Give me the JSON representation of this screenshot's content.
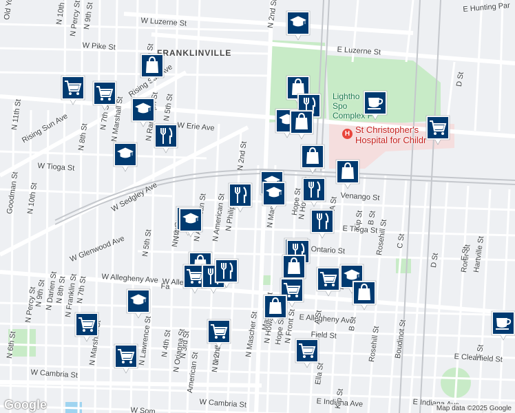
{
  "map": {
    "area_label": "FRANKLINVILLE",
    "park_label": "Lighthouse Sports Complex Field",
    "park_label_visible": "Lightho\nSpo\nComplex F",
    "hospital_label": "St Christopher's\nHospital for Children",
    "hospital_label_visible": "St Christopher's\nHospital for Childr",
    "hospital_icon": "H",
    "google_logo": "Google",
    "attribution": "Map data ©2025 Google",
    "street_labels": [
      "E Hunting Par",
      "W Luzerne St",
      "E Luzerne St",
      "W Pike St",
      "N 10th St",
      "N Percy St",
      "N 9th St",
      "N 6th St",
      "Rising Sun Ave",
      "N 5th St",
      "W Erie Ave",
      "N Randolph St",
      "N Marshall St",
      "N 7th St",
      "N 8th St",
      "N 11th St",
      "Rising Sun Ave",
      "W Tioga St",
      "W Sedgley Ave",
      "N 10th St",
      "Goodman St",
      "W Glenwood Ave",
      "N 5th St",
      "N 4th St",
      "N American St",
      "N Philip St",
      "N 2nd St",
      "N Mascher St",
      "N Howard St",
      "Hope St",
      "Venango St",
      "E Tioga St",
      "B St",
      "Kip St",
      "Rosehill St",
      "C St",
      "D St",
      "Ontario St",
      "Rorer St",
      "Hartville St",
      "E St",
      "W Allegheny Ave",
      "E Allegheny Ave",
      "N Percy St",
      "N 9th St",
      "N Darien St",
      "N 8th St",
      "N Franklin St",
      "N 7th St",
      "N 6th St",
      "N Marshall St",
      "N Lawrence St",
      "N 4th St",
      "N Orianna St",
      "N 3rd St",
      "American St",
      "N 2nd St",
      "N Mascher St",
      "N Howard St",
      "Hope St",
      "N Front St",
      "A St",
      "B St",
      "Rosehill St",
      "Boudinot St",
      "F St",
      "E Clearfield St",
      "Field St",
      "Ella St",
      "E Indiana Ave",
      "E Indiana Ave",
      "W Cambria St",
      "W Cambria St",
      "Old York Rd",
      "N 2nd St",
      "D St",
      "Kip St",
      "A St",
      "W Som",
      "Kip St",
      "N 2nd St",
      "Mascher St",
      "W Allegheny Ave",
      "Fa",
      "N American St",
      "N 4th St",
      "E A"
    ],
    "markers": [
      {
        "type": "school",
        "icon": "graduation-cap-icon"
      },
      {
        "type": "shopping",
        "icon": "shopping-bag-icon"
      },
      {
        "type": "grocery",
        "icon": "shopping-cart-icon"
      },
      {
        "type": "grocery",
        "icon": "shopping-cart-icon"
      },
      {
        "type": "shopping",
        "icon": "shopping-bag-icon"
      },
      {
        "type": "restaurant",
        "icon": "fork-knife-icon"
      },
      {
        "type": "cafe",
        "icon": "coffee-cup-icon"
      },
      {
        "type": "school",
        "icon": "graduation-cap-icon"
      },
      {
        "type": "school",
        "icon": "graduation-cap-icon"
      },
      {
        "type": "shopping",
        "icon": "shopping-bag-icon"
      },
      {
        "type": "grocery",
        "icon": "shopping-cart-icon"
      },
      {
        "type": "restaurant",
        "icon": "fork-knife-icon"
      },
      {
        "type": "school",
        "icon": "graduation-cap-icon"
      },
      {
        "type": "shopping",
        "icon": "shopping-bag-icon"
      },
      {
        "type": "shopping",
        "icon": "shopping-bag-icon"
      },
      {
        "type": "restaurant",
        "icon": "fork-knife-icon"
      },
      {
        "type": "school",
        "icon": "graduation-cap-icon"
      },
      {
        "type": "school",
        "icon": "graduation-cap-icon"
      },
      {
        "type": "restaurant",
        "icon": "fork-knife-icon"
      },
      {
        "type": "school",
        "icon": "graduation-cap-icon"
      },
      {
        "type": "school",
        "icon": "graduation-cap-icon"
      },
      {
        "type": "restaurant",
        "icon": "fork-knife-icon"
      },
      {
        "type": "restaurant",
        "icon": "fork-knife-icon"
      },
      {
        "type": "restaurant",
        "icon": "fork-knife-icon"
      },
      {
        "type": "shopping",
        "icon": "shopping-bag-icon"
      },
      {
        "type": "grocery",
        "icon": "shopping-cart-icon"
      },
      {
        "type": "restaurant",
        "icon": "fork-knife-icon"
      },
      {
        "type": "restaurant",
        "icon": "fork-knife-icon"
      },
      {
        "type": "shopping",
        "icon": "shopping-bag-icon"
      },
      {
        "type": "grocery",
        "icon": "shopping-cart-icon"
      },
      {
        "type": "school",
        "icon": "graduation-cap-icon"
      },
      {
        "type": "grocery",
        "icon": "shopping-cart-icon"
      },
      {
        "type": "shopping",
        "icon": "shopping-bag-icon"
      },
      {
        "type": "school",
        "icon": "graduation-cap-icon"
      },
      {
        "type": "shopping",
        "icon": "shopping-bag-icon"
      },
      {
        "type": "grocery",
        "icon": "shopping-cart-icon"
      },
      {
        "type": "grocery",
        "icon": "shopping-cart-icon"
      },
      {
        "type": "grocery",
        "icon": "shopping-cart-icon"
      },
      {
        "type": "grocery",
        "icon": "shopping-cart-icon"
      },
      {
        "type": "cafe",
        "icon": "coffee-cup-icon"
      }
    ],
    "colors": {
      "background": "#eef0f3",
      "road": "#ffffff",
      "major_road": "#ffffff",
      "rail": "#c4c7cc",
      "park": "#c8ebc7",
      "hospital_area": "#f5dede",
      "marker_fill": "#003a70",
      "marker_border": "#ffffff",
      "label": "#3c4043",
      "hospital_text": "#c5221f",
      "park_text": "#1b7a4d"
    }
  }
}
